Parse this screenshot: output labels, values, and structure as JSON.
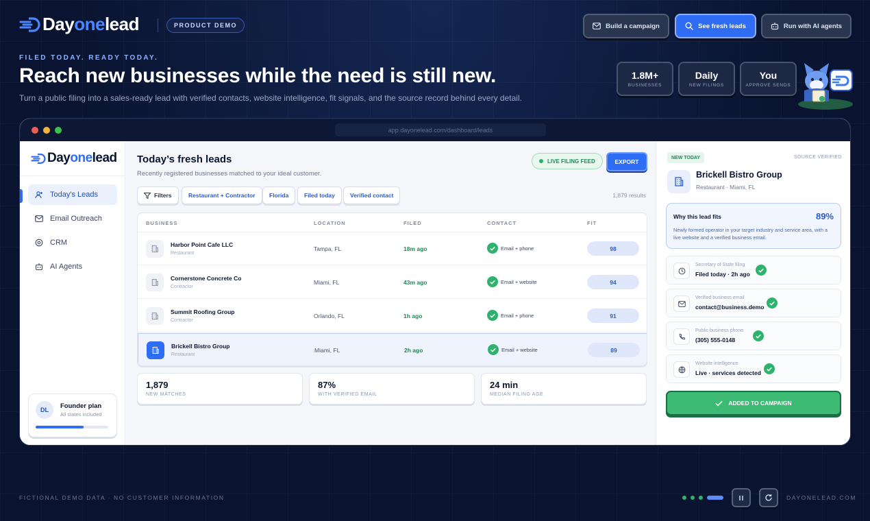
{
  "brand": {
    "pre": "Day",
    "mid": "one",
    "post": "lead"
  },
  "header": {
    "badge": "PRODUCT DEMO",
    "buttons": [
      {
        "label": "Build a campaign",
        "icon": "mail-icon"
      },
      {
        "label": "See fresh leads",
        "icon": "search-icon"
      },
      {
        "label": "Run with AI agents",
        "icon": "robot-icon"
      }
    ]
  },
  "hero": {
    "kicker": "FILED TODAY. READY TODAY.",
    "title": "Reach new businesses while the need is still new.",
    "subtitle": "Turn a public filing into a sales-ready lead with verified contacts, website intelligence, fit signals, and the source record behind every detail."
  },
  "stats": [
    {
      "value": "1.8M+",
      "label": "BUSINESSES"
    },
    {
      "value": "Daily",
      "label": "NEW FILINGS"
    },
    {
      "value": "You",
      "label": "APPROVE SENDS"
    }
  ],
  "browser": {
    "url": "app.dayonelead.com/dashboard/leads"
  },
  "sidebar": {
    "items": [
      {
        "label": "Today's Leads",
        "icon": "user-plus-icon"
      },
      {
        "label": "Email Outreach",
        "icon": "mail-icon"
      },
      {
        "label": "CRM",
        "icon": "target-icon"
      },
      {
        "label": "AI Agents",
        "icon": "robot-icon"
      }
    ],
    "plan": {
      "initials": "DL",
      "title": "Founder plan",
      "subtitle": "All states included",
      "progress": 0.66
    }
  },
  "main": {
    "title": "Today’s fresh leads",
    "subtitle": "Recently registered businesses matched to your ideal customer.",
    "live_label": "LIVE FILING FEED",
    "export_label": "EXPORT",
    "filters_label": "Filters",
    "chips": [
      "Restaurant + Contractor",
      "Florida",
      "Filed today",
      "Verified contact"
    ],
    "results": "1,879 results",
    "columns": [
      "BUSINESS",
      "LOCATION",
      "FILED",
      "CONTACT",
      "FIT"
    ],
    "rows": [
      {
        "name": "Harbor Point Cafe LLC",
        "type": "Restaurant",
        "location": "Tampa, FL",
        "filed": "18m ago",
        "contact": "Email + phone",
        "fit": "98"
      },
      {
        "name": "Cornerstone Concrete Co",
        "type": "Contractor",
        "location": "Miami, FL",
        "filed": "43m ago",
        "contact": "Email + website",
        "fit": "94"
      },
      {
        "name": "Summit Roofing Group",
        "type": "Contractor",
        "location": "Orlando, FL",
        "filed": "1h ago",
        "contact": "Email + phone",
        "fit": "91"
      },
      {
        "name": "Brickell Bistro Group",
        "type": "Restaurant",
        "location": "Miami, FL",
        "filed": "2h ago",
        "contact": "Email + website",
        "fit": "89"
      }
    ],
    "summary": [
      {
        "value": "1,879",
        "label": "NEW MATCHES"
      },
      {
        "value": "87%",
        "label": "WITH VERIFIED EMAIL"
      },
      {
        "value": "24 min",
        "label": "MEDIAN FILING AGE"
      }
    ]
  },
  "detail": {
    "tag": "NEW TODAY",
    "source": "SOURCE VERIFIED",
    "name": "Brickell Bistro Group",
    "location": "Restaurant · Miami, FL",
    "why_title": "Why this lead fits",
    "why_pct": "89%",
    "why_desc": "Newly formed operator in your target industry and service area, with a live website and a verified business email.",
    "items": [
      {
        "label": "Secretary of State filing",
        "value": "Filed today · 2h ago",
        "icon": "clock-icon"
      },
      {
        "label": "Verified business email",
        "value": "contact@business.demo",
        "icon": "mail-icon"
      },
      {
        "label": "Public business phone",
        "value": "(305) 555-0148",
        "icon": "phone-icon"
      },
      {
        "label": "Website intelligence",
        "value": "Live · services detected",
        "icon": "globe-icon"
      }
    ],
    "cta": "ADDED TO CAMPAIGN"
  },
  "footer": {
    "left": "FICTIONAL DEMO DATA · NO CUSTOMER INFORMATION",
    "right": "DAYONELEAD.COM"
  }
}
